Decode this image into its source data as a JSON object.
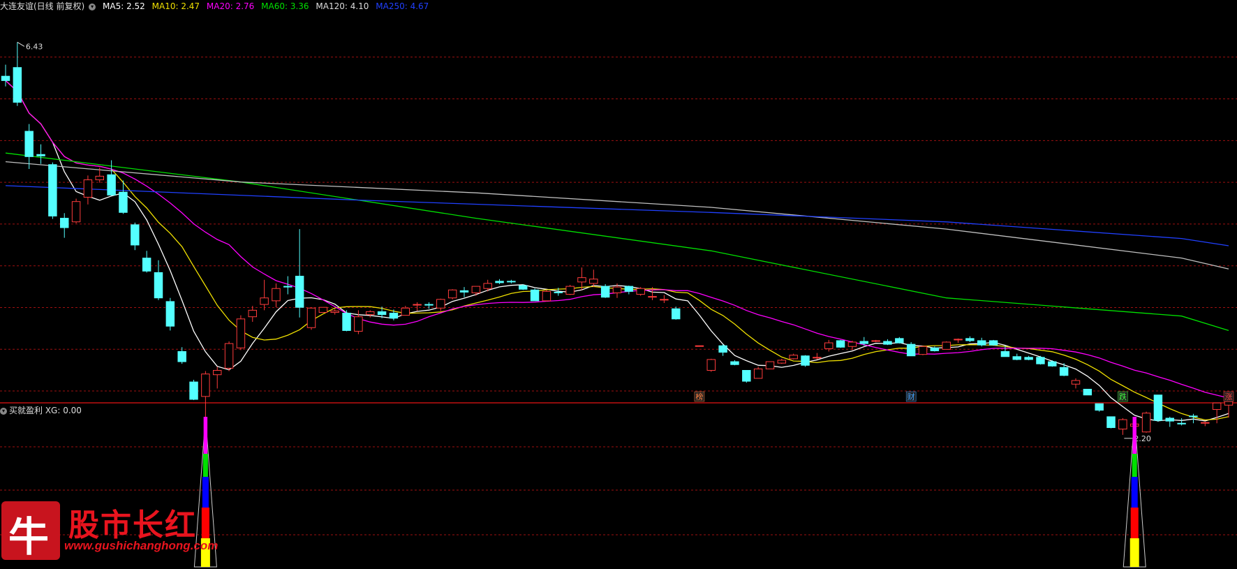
{
  "header": {
    "stock": "大连友谊(日线 前复权)",
    "mas": [
      {
        "label": "MA5: 2.52",
        "color": "#ffffff"
      },
      {
        "label": "MA10: 2.47",
        "color": "#f0e000"
      },
      {
        "label": "MA20: 2.76",
        "color": "#ff00ff"
      },
      {
        "label": "MA60: 3.36",
        "color": "#00e000"
      },
      {
        "label": "MA120: 4.10",
        "color": "#dddddd"
      },
      {
        "label": "MA250: 4.67",
        "color": "#2040ff"
      }
    ]
  },
  "indicator": {
    "title": "买就盈利 XG: 0.00"
  },
  "colors": {
    "up": "#ff3c3c",
    "down": "#54ffff",
    "grid": "#a01010",
    "ma5": "#ffffff",
    "ma10": "#f0e000",
    "ma20": "#ff00ff",
    "ma60": "#00e000",
    "ma120": "#c0c0c0",
    "ma250": "#2040ff"
  },
  "chart_data": {
    "type": "candlestick",
    "ylim": [
      1.5,
      6.8
    ],
    "candles": [
      [
        5.96,
        6.12,
        5.82,
        5.9
      ],
      [
        6.08,
        6.43,
        5.55,
        5.6
      ],
      [
        5.2,
        5.3,
        4.68,
        4.85
      ],
      [
        4.88,
        5.02,
        4.75,
        4.86
      ],
      [
        4.74,
        4.77,
        3.99,
        4.03
      ],
      [
        4.0,
        4.07,
        3.73,
        3.87
      ],
      [
        3.95,
        4.27,
        3.93,
        4.23
      ],
      [
        4.29,
        4.59,
        4.19,
        4.53
      ],
      [
        4.53,
        4.7,
        4.49,
        4.58
      ],
      [
        4.6,
        4.8,
        4.31,
        4.32
      ],
      [
        4.36,
        4.52,
        4.06,
        4.08
      ],
      [
        3.91,
        3.94,
        3.56,
        3.63
      ],
      [
        3.45,
        3.55,
        3.25,
        3.27
      ],
      [
        3.25,
        3.42,
        2.87,
        2.9
      ],
      [
        2.85,
        2.9,
        2.45,
        2.51
      ],
      [
        2.16,
        2.22,
        1.99,
        2.02
      ],
      [
        1.74,
        1.77,
        1.49,
        1.5
      ],
      [
        1.54,
        1.89,
        1.25,
        1.85
      ],
      [
        1.84,
        1.95,
        1.65,
        1.9
      ],
      [
        1.93,
        2.3,
        1.89,
        2.27
      ],
      [
        2.21,
        2.66,
        2.18,
        2.61
      ],
      [
        2.64,
        2.79,
        2.57,
        2.73
      ],
      [
        2.81,
        3.15,
        2.73,
        2.9
      ],
      [
        2.86,
        3.1,
        2.77,
        3.03
      ],
      [
        3.06,
        3.2,
        2.95,
        3.05
      ],
      [
        3.2,
        3.85,
        2.63,
        2.77
      ],
      [
        2.49,
        2.77,
        2.46,
        2.76
      ],
      [
        2.7,
        2.77,
        2.77,
        2.77
      ],
      [
        2.7,
        2.75,
        2.67,
        2.72
      ],
      [
        2.69,
        2.73,
        2.44,
        2.45
      ],
      [
        2.44,
        2.73,
        2.4,
        2.64
      ],
      [
        2.67,
        2.73,
        2.63,
        2.71
      ],
      [
        2.71,
        2.78,
        2.62,
        2.67
      ],
      [
        2.69,
        2.74,
        2.59,
        2.62
      ],
      [
        2.66,
        2.79,
        2.66,
        2.76
      ],
      [
        2.81,
        2.84,
        2.72,
        2.81
      ],
      [
        2.81,
        2.84,
        2.75,
        2.8
      ],
      [
        2.76,
        2.89,
        2.72,
        2.88
      ],
      [
        2.9,
        3.02,
        2.88,
        3.01
      ],
      [
        3.0,
        3.05,
        2.91,
        2.98
      ],
      [
        2.97,
        3.06,
        2.93,
        3.06
      ],
      [
        3.03,
        3.15,
        2.99,
        3.1
      ],
      [
        3.13,
        3.16,
        3.09,
        3.11
      ],
      [
        3.13,
        3.15,
        3.1,
        3.12
      ],
      [
        3.07,
        3.09,
        3.01,
        3.02
      ],
      [
        3.01,
        3.03,
        2.86,
        2.86
      ],
      [
        2.86,
        3.01,
        2.85,
        2.99
      ],
      [
        2.98,
        3.04,
        2.93,
        2.97
      ],
      [
        2.95,
        3.08,
        2.94,
        3.06
      ],
      [
        3.12,
        3.32,
        3.01,
        3.18
      ],
      [
        3.1,
        3.29,
        3.05,
        3.16
      ],
      [
        3.06,
        3.09,
        2.9,
        2.91
      ],
      [
        2.97,
        3.1,
        2.9,
        3.05
      ],
      [
        3.06,
        3.07,
        2.95,
        2.99
      ],
      [
        2.95,
        3.05,
        2.93,
        3.03
      ],
      [
        2.91,
        3.05,
        2.87,
        2.92
      ],
      [
        2.87,
        2.94,
        2.83,
        2.88
      ],
      [
        2.75,
        2.78,
        2.6,
        2.61
      ],
      [
        null,
        null,
        null,
        null
      ],
      [
        2.24,
        2.24,
        2.24,
        2.24
      ],
      [
        1.9,
        2.06,
        1.88,
        2.05
      ],
      [
        2.24,
        2.26,
        2.1,
        2.15
      ],
      [
        2.02,
        2.04,
        1.97,
        1.98
      ],
      [
        1.9,
        1.9,
        1.73,
        1.75
      ],
      [
        1.79,
        1.95,
        1.79,
        1.92
      ],
      [
        1.92,
        2.02,
        1.92,
        2.02
      ],
      [
        2.0,
        2.06,
        1.99,
        2.04
      ],
      [
        2.06,
        2.13,
        2.05,
        2.11
      ],
      [
        2.1,
        2.11,
        1.95,
        1.97
      ],
      [
        2.07,
        2.14,
        2.05,
        2.08
      ],
      [
        2.2,
        2.32,
        2.16,
        2.28
      ],
      [
        2.31,
        2.32,
        2.21,
        2.22
      ],
      [
        2.23,
        2.31,
        2.18,
        2.29
      ],
      [
        2.3,
        2.36,
        2.24,
        2.27
      ],
      [
        2.3,
        2.32,
        2.29,
        2.31
      ],
      [
        2.3,
        2.33,
        2.25,
        2.26
      ],
      [
        2.34,
        2.36,
        2.27,
        2.28
      ],
      [
        2.26,
        2.29,
        2.11,
        2.1
      ],
      [
        2.12,
        2.24,
        2.11,
        2.23
      ],
      [
        2.21,
        2.23,
        2.16,
        2.17
      ],
      [
        2.19,
        2.3,
        2.19,
        2.29
      ],
      [
        2.32,
        2.34,
        2.28,
        2.33
      ],
      [
        2.34,
        2.37,
        2.29,
        2.31
      ],
      [
        2.31,
        2.35,
        2.23,
        2.25
      ],
      [
        2.31,
        2.32,
        2.24,
        2.25
      ],
      [
        2.16,
        2.24,
        2.09,
        2.09
      ],
      [
        2.09,
        2.13,
        2.04,
        2.05
      ],
      [
        2.08,
        2.1,
        2.04,
        2.05
      ],
      [
        2.08,
        2.1,
        1.98,
        1.99
      ],
      [
        2.02,
        2.04,
        1.95,
        1.96
      ],
      [
        1.94,
        2.0,
        1.82,
        1.83
      ],
      [
        1.71,
        1.79,
        1.65,
        1.76
      ],
      [
        1.64,
        1.64,
        1.56,
        1.56
      ],
      [
        1.44,
        1.44,
        1.33,
        1.35
      ],
      [
        1.26,
        1.26,
        1.1,
        1.11
      ],
      [
        1.09,
        1.24,
        1.01,
        1.22
      ],
      [
        1.13,
        1.19,
        1.09,
        1.16
      ],
      [
        1.05,
        1.33,
        1.04,
        1.31
      ],
      [
        1.56,
        1.56,
        1.19,
        1.21
      ],
      [
        1.24,
        1.26,
        1.12,
        1.2
      ],
      [
        1.17,
        1.24,
        1.14,
        1.16
      ],
      [
        1.27,
        1.3,
        1.17,
        1.26
      ],
      [
        1.18,
        1.19,
        1.13,
        1.18
      ],
      [
        1.36,
        1.42,
        1.17,
        1.45
      ],
      [
        1.42,
        1.57,
        1.25,
        1.47
      ]
    ],
    "hi_label": "6.43",
    "lo_label": "2.20",
    "markers": [
      {
        "text": "榜",
        "color": "#ff8040",
        "index": 59
      },
      {
        "text": "财",
        "color": "#40a0ff",
        "index": 77
      },
      {
        "text": "跌",
        "color": "#40ff40",
        "index": 95
      },
      {
        "text": "涨",
        "color": "#ff4040",
        "index": 104
      }
    ],
    "signals": [
      17,
      96
    ]
  },
  "logo": {
    "char": "牛",
    "name": "股市长红",
    "url": "www.gushichanghong.com"
  }
}
